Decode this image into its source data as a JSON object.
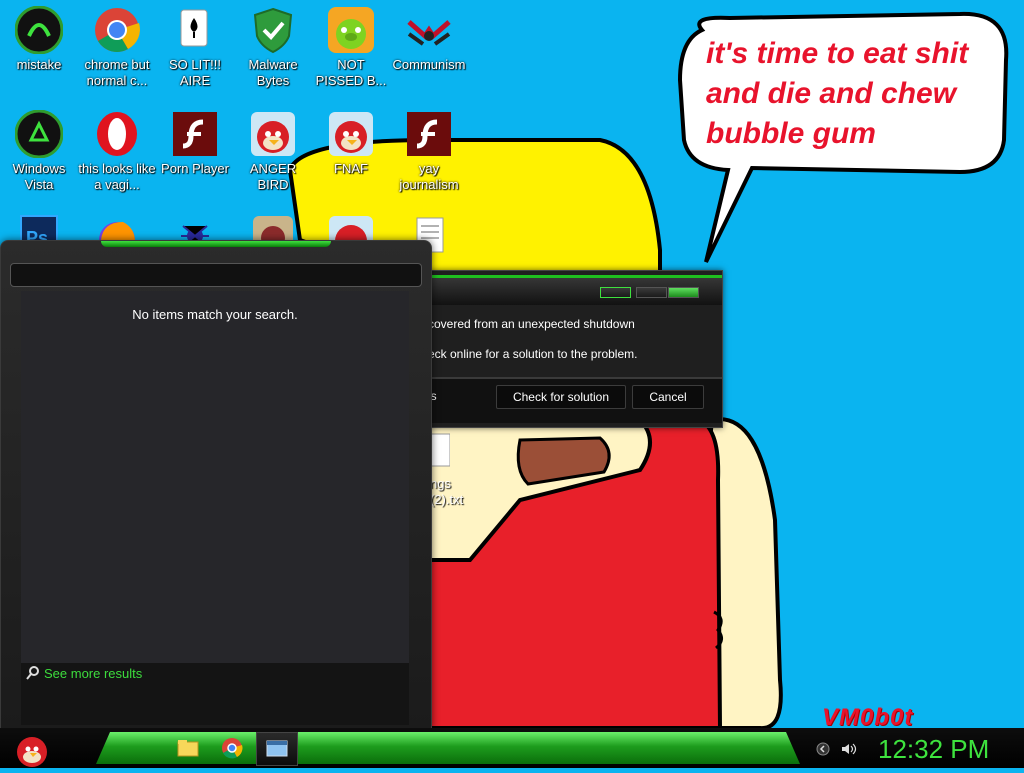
{
  "speech_bubble": [
    "it's time to eat shit",
    "and die and chew",
    "bubble gum"
  ],
  "signature": "VM0b0t",
  "desktop_icons": [
    {
      "name": "mistake",
      "label": "mistake",
      "icon": "razer-icon"
    },
    {
      "name": "chrome",
      "label": "chrome but normal c...",
      "icon": "chrome-icon"
    },
    {
      "name": "solitaire",
      "label": "SO LIT!!! AIRE",
      "icon": "solitaire-icon"
    },
    {
      "name": "malwarebytes",
      "label": "Malware Bytes",
      "icon": "shield-check-icon"
    },
    {
      "name": "not-pissed",
      "label": "NOT PISSED B...",
      "icon": "pig-icon"
    },
    {
      "name": "communism",
      "label": "Communism",
      "icon": "communism-logo-icon"
    },
    {
      "name": "windows-vista",
      "label": "Windows Vista",
      "icon": "recycle-icon"
    },
    {
      "name": "opera",
      "label": "this looks like a vagi...",
      "icon": "opera-icon"
    },
    {
      "name": "porn-player",
      "label": "Porn Player",
      "icon": "flash-icon"
    },
    {
      "name": "anger-bird",
      "label": "ANGER BIRD",
      "icon": "angry-bird-icon"
    },
    {
      "name": "fnaf",
      "label": "FNAF",
      "icon": "angry-bird-icon"
    },
    {
      "name": "yay-journalism",
      "label": "yay journalism",
      "icon": "flash-icon"
    },
    {
      "name": "photoshop",
      "label": "",
      "icon": "photoshop-icon"
    },
    {
      "name": "firefox",
      "label": "",
      "icon": "firefox-icon"
    },
    {
      "name": "spider",
      "label": "",
      "icon": "spider-solitaire-icon"
    },
    {
      "name": "game",
      "label": "",
      "icon": "game-icon"
    },
    {
      "name": "bird2",
      "label": "",
      "icon": "angry-bird-icon"
    },
    {
      "name": "notepad",
      "label": "",
      "icon": "text-file-icon"
    },
    {
      "name": "partial-txt",
      "label": "ngs\n(2).txt",
      "icon": "text-file-icon"
    }
  ],
  "search_panel": {
    "no_results": "No items match your search.",
    "see_more": "See more results"
  },
  "dialog": {
    "line1": "covered from an unexpected shutdown",
    "line2": "eck online for a solution to the problem.",
    "footer_text": "ls",
    "check_button": "Check for solution",
    "cancel_button": "Cancel"
  },
  "taskbar": {
    "start_icon": "angry-bird-icon",
    "pinned": [
      "explorer-icon",
      "chrome-icon",
      "window-icon"
    ],
    "tray": [
      "show-hidden-icon",
      "volume-icon"
    ],
    "clock": "12:32 PM"
  },
  "colors": {
    "desktop": "#0ab4f0",
    "accent_green": "#3ee33e",
    "bubble_text": "#e8132c"
  }
}
